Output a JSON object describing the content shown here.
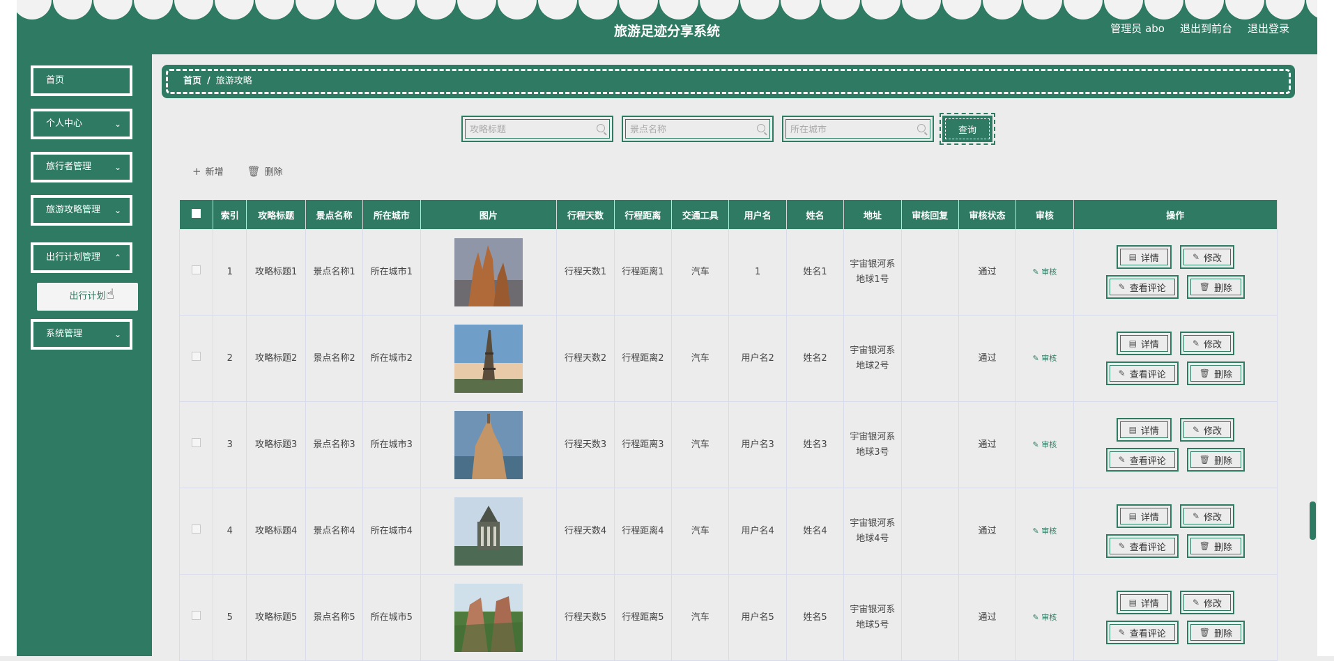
{
  "header": {
    "title": "旅游足迹分享系统",
    "admin": "管理员 abo",
    "back_front": "退出到前台",
    "logout": "退出登录"
  },
  "sidebar": {
    "items": [
      {
        "label": "首页"
      },
      {
        "label": "个人中心"
      },
      {
        "label": "旅行者管理"
      },
      {
        "label": "旅游攻略管理"
      },
      {
        "label": "出行计划管理"
      },
      {
        "label": "系统管理"
      }
    ],
    "sub_item": "出行计划"
  },
  "breadcrumb": {
    "home": "首页",
    "sep": "/",
    "current": "旅游攻略"
  },
  "search": {
    "title_placeholder": "攻略标题",
    "spot_placeholder": "景点名称",
    "city_placeholder": "所在城市",
    "query": "查询"
  },
  "toolbar": {
    "add": "新增",
    "delete": "删除"
  },
  "table": {
    "headers": [
      "",
      "索引",
      "攻略标题",
      "景点名称",
      "所在城市",
      "图片",
      "行程天数",
      "行程距离",
      "交通工具",
      "用户名",
      "姓名",
      "地址",
      "审核回复",
      "审核状态",
      "审核",
      "操作"
    ],
    "audit_label": "审核",
    "btn_detail": "详情",
    "btn_edit": "修改",
    "btn_comments": "查看评论",
    "btn_delete": "删除",
    "rows": [
      {
        "idx": "1",
        "title": "攻略标题1",
        "spot": "景点名称1",
        "city": "所在城市1",
        "days": "行程天数1",
        "distance": "行程距离1",
        "transport": "汽车",
        "username": "1",
        "name": "姓名1",
        "address": "宇宙银河系地球1号",
        "reply": "",
        "status": "通过"
      },
      {
        "idx": "2",
        "title": "攻略标题2",
        "spot": "景点名称2",
        "city": "所在城市2",
        "days": "行程天数2",
        "distance": "行程距离2",
        "transport": "汽车",
        "username": "用户名2",
        "name": "姓名2",
        "address": "宇宙银河系地球2号",
        "reply": "",
        "status": "通过"
      },
      {
        "idx": "3",
        "title": "攻略标题3",
        "spot": "景点名称3",
        "city": "所在城市3",
        "days": "行程天数3",
        "distance": "行程距离3",
        "transport": "汽车",
        "username": "用户名3",
        "name": "姓名3",
        "address": "宇宙银河系地球3号",
        "reply": "",
        "status": "通过"
      },
      {
        "idx": "4",
        "title": "攻略标题4",
        "spot": "景点名称4",
        "city": "所在城市4",
        "days": "行程天数4",
        "distance": "行程距离4",
        "transport": "汽车",
        "username": "用户名4",
        "name": "姓名4",
        "address": "宇宙银河系地球4号",
        "reply": "",
        "status": "通过"
      },
      {
        "idx": "5",
        "title": "攻略标题5",
        "spot": "景点名称5",
        "city": "所在城市5",
        "days": "行程天数5",
        "distance": "行程距离5",
        "transport": "汽车",
        "username": "用户名5",
        "name": "姓名5",
        "address": "宇宙银河系地球5号",
        "reply": "",
        "status": "通过"
      }
    ]
  },
  "colors": {
    "primary": "#2f7a62",
    "background": "#ececec"
  }
}
